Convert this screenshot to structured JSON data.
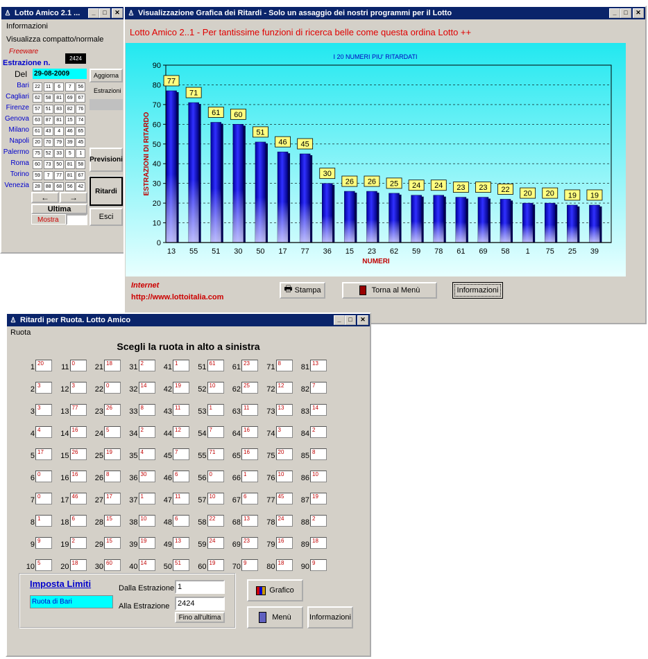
{
  "win1": {
    "title": "Lotto Amico 2.1 ...",
    "menu": [
      "Informazioni",
      "Visualizza compatto/normale"
    ],
    "freeware": "Freeware",
    "estrazione_label": "Estrazione n.",
    "estrazione_num": "2424",
    "del_label": "Del",
    "date": "29-08-2009",
    "wheels": [
      {
        "name": "Bari",
        "nums": [
          "22",
          "11",
          "6",
          "7",
          "56"
        ]
      },
      {
        "name": "Cagliari",
        "nums": [
          "62",
          "58",
          "81",
          "69",
          "67"
        ]
      },
      {
        "name": "Firenze",
        "nums": [
          "57",
          "51",
          "83",
          "82",
          "76"
        ]
      },
      {
        "name": "Genova",
        "nums": [
          "63",
          "87",
          "81",
          "15",
          "74"
        ]
      },
      {
        "name": "Milano",
        "nums": [
          "61",
          "43",
          "4",
          "46",
          "65"
        ]
      },
      {
        "name": "Napoli",
        "nums": [
          "20",
          "70",
          "79",
          "39",
          "45"
        ]
      },
      {
        "name": "Palermo",
        "nums": [
          "75",
          "52",
          "33",
          "5",
          "1"
        ]
      },
      {
        "name": "Roma",
        "nums": [
          "60",
          "73",
          "50",
          "81",
          "58"
        ]
      },
      {
        "name": "Torino",
        "nums": [
          "59",
          "7",
          "77",
          "81",
          "67"
        ]
      },
      {
        "name": "Venezia",
        "nums": [
          "28",
          "88",
          "68",
          "56",
          "42"
        ]
      }
    ],
    "aggiorna": "Aggiorna",
    "estrazioni": "Estrazioni",
    "previsioni": "Previsioni",
    "ritardi": "Ritardi",
    "esci": "Esci",
    "prev_arrow": "←",
    "next_arrow": "→",
    "ultima": "Ultima",
    "mostra": "Mostra"
  },
  "win2": {
    "title": "Visualizzazione Grafica dei Ritardi - Solo un assaggio dei nostri programmi per il Lotto",
    "header": "Lotto Amico 2..1 - Per tantissime funzioni di ricerca belle come questa ordina Lotto ++",
    "internet": "Internet",
    "url": "http://www.lottoitalia.com",
    "stampa": "Stampa",
    "torna": "Torna al Menù",
    "informazioni": "Informazioni"
  },
  "chart_data": {
    "type": "bar",
    "title": "I 20 NUMERI PIU' RITARDATI",
    "xlabel": "NUMERI",
    "ylabel": "ESTRAZIONI DI RITARDO",
    "ylim": [
      0,
      90
    ],
    "yticks": [
      "0",
      "10",
      "20",
      "30",
      "40",
      "50",
      "60",
      "70",
      "80",
      "90"
    ],
    "categories": [
      "13",
      "55",
      "51",
      "30",
      "50",
      "17",
      "77",
      "36",
      "15",
      "23",
      "62",
      "59",
      "78",
      "61",
      "69",
      "58",
      "1",
      "75",
      "25",
      "39"
    ],
    "values": [
      77,
      71,
      61,
      60,
      51,
      46,
      45,
      30,
      26,
      26,
      25,
      24,
      24,
      23,
      23,
      22,
      20,
      20,
      19,
      19
    ],
    "bar_color": "#1010c0",
    "grid": true
  },
  "win3": {
    "title": "Ritardi per Ruota. Lotto Amico",
    "menu": "Ruota",
    "heading": "Scegli la ruota in alto a sinistra",
    "ritardi": [
      [
        20,
        3,
        3,
        4,
        17,
        0,
        0,
        1,
        9,
        5
      ],
      [
        0,
        3,
        77,
        16,
        26,
        16,
        46,
        6,
        2,
        18
      ],
      [
        18,
        0,
        26,
        5,
        19,
        8,
        17,
        15,
        15,
        60
      ],
      [
        2,
        14,
        8,
        2,
        4,
        30,
        1,
        10,
        19,
        14
      ],
      [
        1,
        19,
        11,
        12,
        7,
        6,
        11,
        6,
        13,
        51
      ],
      [
        61,
        10,
        1,
        7,
        71,
        0,
        10,
        22,
        24,
        19
      ],
      [
        23,
        25,
        11,
        16,
        16,
        1,
        6,
        13,
        23,
        9
      ],
      [
        8,
        12,
        13,
        3,
        20,
        10,
        45,
        24,
        16,
        18
      ],
      [
        13,
        7,
        14,
        2,
        8,
        10,
        19,
        2,
        18,
        9
      ]
    ],
    "imposta": "Imposta Limiti",
    "ruota_sel": "Ruota di Bari",
    "dalla": "Dalla Estrazione",
    "dalla_val": "1",
    "alla": "Alla Estrazione",
    "alla_val": "2424",
    "fino": "Fino all'ultima",
    "grafico": "Grafico",
    "menu_btn": "Menù",
    "informazioni": "Informazioni"
  }
}
